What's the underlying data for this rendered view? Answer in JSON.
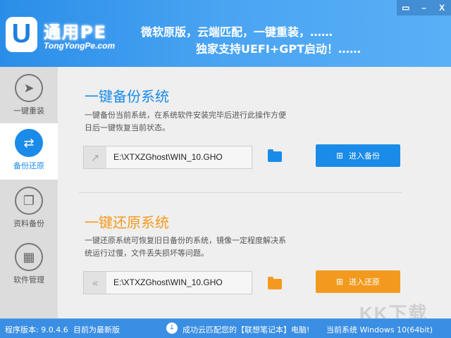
{
  "header": {
    "logo_letter": "U",
    "logo_title": "通用PE",
    "logo_sub": "TongYongPe.com",
    "slogan1": "微软原版，云端匹配，一键重装，……",
    "slogan2": "独家支持UEFI+GPT启动！……",
    "controls": {
      "feedback": "▭",
      "minimize": "–",
      "close": "X"
    }
  },
  "sidebar": {
    "items": [
      {
        "label": "一键重装",
        "icon": "cursor-arrow-icon",
        "glyph": "➤"
      },
      {
        "label": "备份还原",
        "icon": "sync-icon",
        "glyph": "⇄",
        "selected": true
      },
      {
        "label": "资料备份",
        "icon": "copy-icon",
        "glyph": "❐"
      },
      {
        "label": "软件管理",
        "icon": "apps-grid-icon",
        "glyph": "▦"
      }
    ]
  },
  "backup": {
    "title": "一键备份系统",
    "desc": "一键备份当前系统，在系统软件安装完毕后进行此操作方便日后一键恢复当前状态。",
    "path": "E:\\XTXZGhost\\WIN_10.GHO",
    "button": "进入备份",
    "color": "#1a8be8"
  },
  "restore": {
    "title": "一键还原系统",
    "desc": "一键还原系统可恢复旧日备份的系统，镜像一定程度解决系统运行过慢，文件丢失损坏等问题。",
    "path": "E:\\XTXZGhost\\WIN_10.GHO",
    "button": "进入还原",
    "color": "#f39a1e"
  },
  "footer": {
    "version": "程序版本: 9.0.4.6",
    "latest": "目前为最新版",
    "match": "成功云匹配您的【联想笔记本】电脑!",
    "system": "当前系统 Windows 10(64bit)"
  },
  "watermark": "KK下载"
}
